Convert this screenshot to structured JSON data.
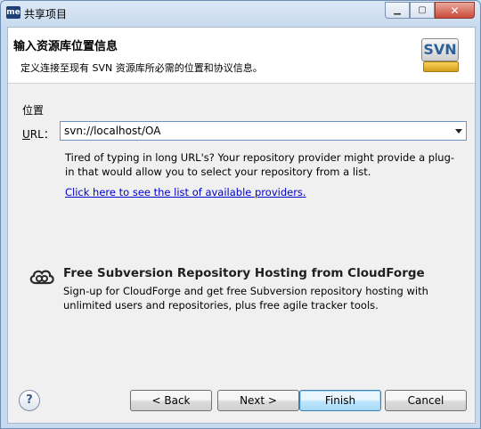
{
  "window": {
    "app_icon": "me",
    "title": "共享项目",
    "controls": {
      "minimize": "minimize-icon",
      "maximize": "maximize-icon",
      "close": "close-icon"
    }
  },
  "header": {
    "title": "输入资源库位置信息",
    "description": "定义连接至现有 SVN 资源库所必需的位置和协议信息。",
    "logo_text": "SVN"
  },
  "location": {
    "group_label": "位置",
    "url_label_prefix": "U",
    "url_label_rest": "RL：",
    "url_value": "svn://localhost/OA",
    "hint": "Tired of typing in long URL's?  Your repository provider might provide a plug-in that would allow you to select your repository from a list.",
    "providers_link": "Click here to see the list of available providers."
  },
  "cloudforge": {
    "title": "Free Subversion Repository Hosting from CloudForge",
    "description": "Sign-up for CloudForge and get free Subversion repository hosting with unlimited users and repositories, plus free agile tracker tools."
  },
  "buttons": {
    "help": "?",
    "back": "< Back",
    "next": "Next >",
    "finish": "Finish",
    "cancel": "Cancel"
  }
}
